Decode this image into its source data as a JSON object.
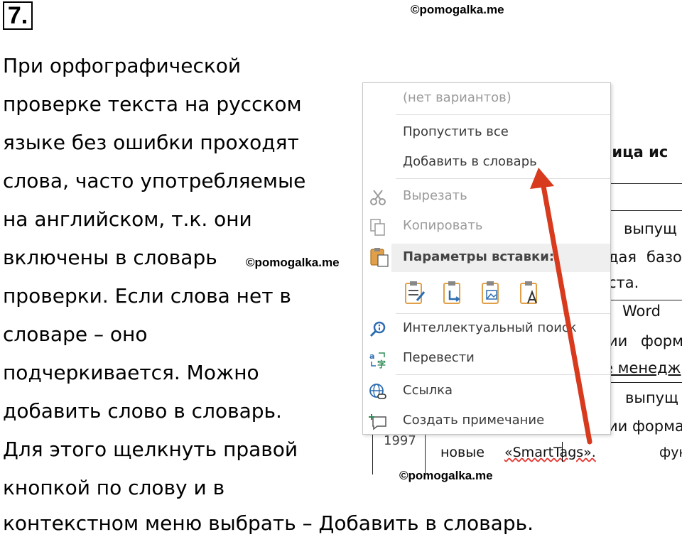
{
  "task": {
    "number": "7."
  },
  "watermarks": [
    "©pomogalka.me",
    "©pomogalka.me",
    "©pomogalka.me"
  ],
  "answer_lines": [
    "При орфографической",
    "проверке текста на русском",
    "языке без ошибки проходят",
    "слова, часто употребляемые",
    "на английском, т.к. они",
    "включены в словарь",
    "проверки. Если слова нет в",
    "словаре – оно",
    "подчеркивается. Можно",
    "добавить слово в словарь.",
    "Для этого щелкнуть правой",
    "кнопкой по слову и в",
    "контекстном меню выбрать – Добавить в словарь."
  ],
  "document_fragments": {
    "heading": "лица ис",
    "row1": "выпущ",
    "row2a": "дая",
    "row2b": "базо",
    "row3": "ста.",
    "row4": "Word",
    "row5a": "ии",
    "row5b": "форм",
    "row6": "е менедж",
    "row7": "выпущ",
    "row8": "ии форма",
    "year": "1997",
    "row9a": "новые",
    "row9b": "«SmartTags».",
    "row9c": "фун"
  },
  "context_menu": {
    "no_suggestions": "(нет вариантов)",
    "ignore_all": "Пропустить все",
    "add_to_dictionary": "Добавить в словарь",
    "cut": "Вырезать",
    "copy": "Копировать",
    "paste_options": "Параметры вставки:",
    "smart_lookup": "Интеллектуальный поиск",
    "translate": "Перевести",
    "link": "Ссылка",
    "new_comment": "Создать примечание"
  },
  "colors": {
    "arrow": "#d83a1e",
    "menu_header_bg": "#efefef",
    "disabled_text": "#9a9a9a"
  }
}
